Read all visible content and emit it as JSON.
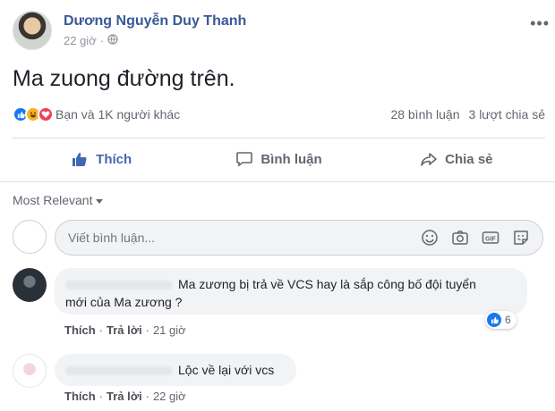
{
  "post": {
    "author": "Dương Nguyễn Duy Thanh",
    "time": "22 giờ",
    "privacy_icon": "globe-icon",
    "text": "Ma zuong đường trên.",
    "reactions_text": "Bạn và 1K người khác",
    "comments_count": "28 bình luận",
    "shares_count": "3 lượt chia sẻ"
  },
  "actions": {
    "like": "Thích",
    "comment": "Bình luận",
    "share": "Chia sẻ"
  },
  "sort_label": "Most Relevant",
  "composer": {
    "placeholder": "Viết bình luận..."
  },
  "comments": [
    {
      "text_line1": "Ma zương bị trả về VCS hay là sắp công bố đội tuyển",
      "text_line2": "mới của Ma zương ?",
      "like_label": "Thích",
      "reply_label": "Trả lời",
      "time": "21 giờ",
      "reaction_count": "6"
    },
    {
      "text_line1": "Lộc về lại với vcs",
      "like_label": "Thích",
      "reply_label": "Trả lời",
      "time": "22 giờ"
    }
  ],
  "colors": {
    "link_blue": "#385898",
    "like_blue": "#4267b2",
    "bubble_bg": "#f2f3f5"
  }
}
